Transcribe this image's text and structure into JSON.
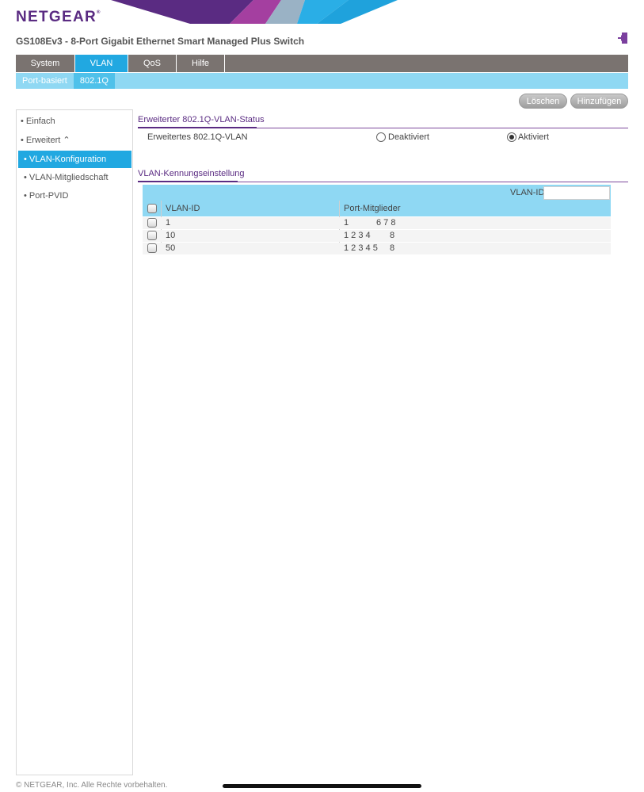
{
  "brand": {
    "logo_text": "NETGEAR",
    "logo_mark": "®",
    "device_title": "GS108Ev3 - 8-Port Gigabit Ethernet Smart Managed Plus Switch"
  },
  "icons": {
    "logout": "logout-icon"
  },
  "nav": {
    "tabs": [
      {
        "label": "System",
        "active": false
      },
      {
        "label": "VLAN",
        "active": true
      },
      {
        "label": "QoS",
        "active": false
      },
      {
        "label": "Hilfe",
        "active": false
      }
    ]
  },
  "subnav": {
    "items": [
      {
        "label": "Port-basiert",
        "active": false
      },
      {
        "label": "802.1Q",
        "active": true
      }
    ]
  },
  "actions": {
    "delete_label": "Löschen",
    "add_label": "Hinzufügen"
  },
  "sidebar": {
    "items": [
      {
        "label": "• Einfach"
      },
      {
        "label": "• Erweitert ⌃"
      },
      {
        "label": "• VLAN-Konfiguration",
        "active": true
      },
      {
        "label": "• VLAN-Mitgliedschaft"
      },
      {
        "label": "• Port-PVID"
      }
    ]
  },
  "status_section": {
    "title": "Erweiterter 802.1Q-VLAN-Status",
    "row_label": "Erweitertes 802.1Q-VLAN",
    "option_disabled": "Deaktiviert",
    "option_enabled": "Aktiviert",
    "selected": "Aktiviert"
  },
  "id_section": {
    "title": "VLAN-Kennungseinstellung",
    "vlan_id_label": "VLAN-ID",
    "vlan_id_value": "",
    "columns": [
      "VLAN-ID",
      "Port-Mitglieder"
    ],
    "rows": [
      {
        "vlan_id": "1",
        "ports_a": "1",
        "ports_b": "6 7 8"
      },
      {
        "vlan_id": "10",
        "ports_a": "1 2 3 4",
        "ports_b": "8"
      },
      {
        "vlan_id": "50",
        "ports_a": "1 2 3 4 5",
        "ports_b": "8"
      }
    ]
  },
  "footer": {
    "copyright": "© NETGEAR, Inc. Alle Rechte vorbehalten."
  },
  "colors": {
    "brand": "#5a2b82",
    "accent": "#21a8e1",
    "light_accent": "#8fd8f3",
    "nav_bg": "#7a7370"
  }
}
